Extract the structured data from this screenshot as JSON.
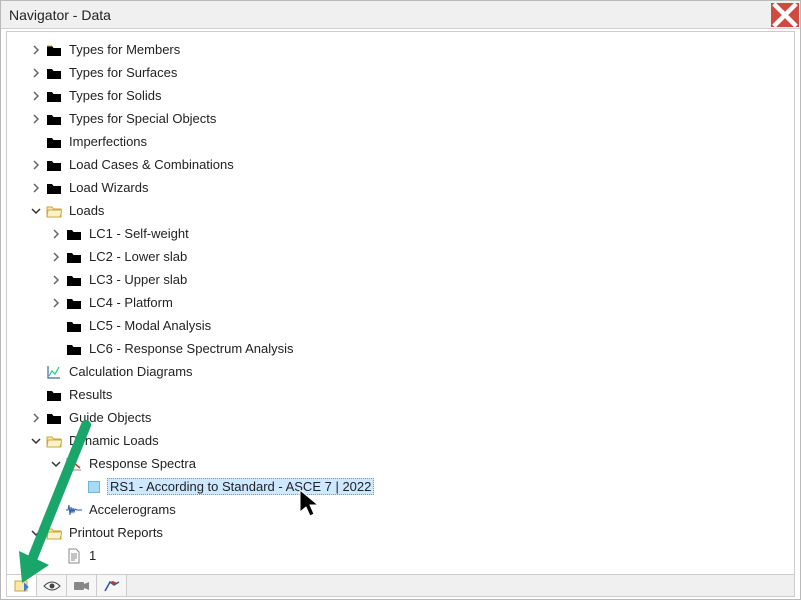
{
  "window": {
    "title": "Navigator - Data"
  },
  "tree": {
    "typesMembers": "Types for Members",
    "typesSurfaces": "Types for Surfaces",
    "typesSolids": "Types for Solids",
    "typesSpecial": "Types for Special Objects",
    "imperfections": "Imperfections",
    "loadCasesCombos": "Load Cases & Combinations",
    "loadWizards": "Load Wizards",
    "loads": "Loads",
    "lc1": "LC1 - Self-weight",
    "lc2": "LC2 - Lower slab",
    "lc3": "LC3 - Upper slab",
    "lc4": "LC4 - Platform",
    "lc5": "LC5 - Modal Analysis",
    "lc6": "LC6 - Response Spectrum Analysis",
    "calcDiagrams": "Calculation Diagrams",
    "results": "Results",
    "guideObjects": "Guide Objects",
    "dynamicLoads": "Dynamic Loads",
    "responseSpectra": "Response Spectra",
    "rs1": "RS1 - According to Standard - ASCE 7 | 2022",
    "accelerograms": "Accelerograms",
    "printoutReports": "Printout Reports",
    "report1": "1"
  }
}
